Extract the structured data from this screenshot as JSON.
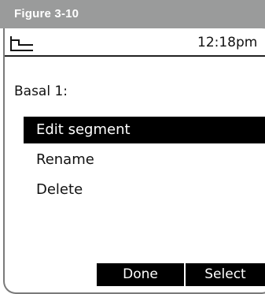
{
  "figure": {
    "label": "Figure 3-10"
  },
  "status_bar": {
    "icon": "basal-program-icon",
    "time": "12:18pm"
  },
  "screen": {
    "title": "Basal 1:"
  },
  "menu": {
    "items": [
      {
        "label": "Edit segment",
        "selected": true
      },
      {
        "label": "Rename",
        "selected": false
      },
      {
        "label": "Delete",
        "selected": false
      }
    ]
  },
  "softkeys": {
    "left": "Done",
    "right": "Select"
  },
  "colors": {
    "figure_bar": "#9a9b9b",
    "highlight": "#000000",
    "text": "#111111"
  }
}
